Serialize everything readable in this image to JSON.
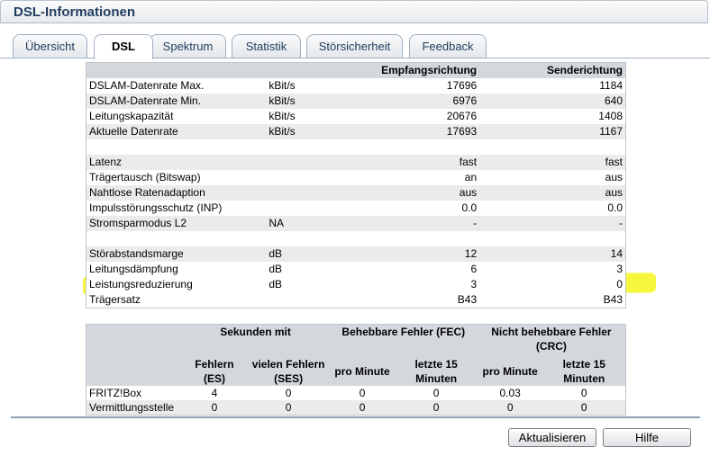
{
  "window": {
    "title": "DSL-Informationen"
  },
  "tabs": [
    {
      "label": "Übersicht"
    },
    {
      "label": "DSL"
    },
    {
      "label": "Spektrum"
    },
    {
      "label": "Statistik"
    },
    {
      "label": "Störsicherheit"
    },
    {
      "label": "Feedback"
    }
  ],
  "active_tab": "DSL",
  "info_table": {
    "headers": [
      "",
      "",
      "Empfangsrichtung",
      "Senderichtung"
    ],
    "rows": [
      [
        "DSLAM-Datenrate Max.",
        "kBit/s",
        "17696",
        "1184"
      ],
      [
        "DSLAM-Datenrate Min.",
        "kBit/s",
        "6976",
        "640"
      ],
      [
        "Leitungskapazität",
        "kBit/s",
        "20676",
        "1408"
      ],
      [
        "Aktuelle Datenrate",
        "kBit/s",
        "17693",
        "1167"
      ],
      [
        "",
        "",
        "",
        ""
      ],
      [
        "Latenz",
        "",
        "fast",
        "fast"
      ],
      [
        "Trägertausch (Bitswap)",
        "",
        "an",
        "aus"
      ],
      [
        "Nahtlose Ratenadaption",
        "",
        "aus",
        "aus"
      ],
      [
        "Impulsstörungsschutz (INP)",
        "",
        "0.0",
        "0.0"
      ],
      [
        "Stromsparmodus L2",
        "NA",
        "-",
        "-"
      ],
      [
        "",
        "",
        "",
        ""
      ],
      [
        "Störabstandsmarge",
        "dB",
        "12",
        "14"
      ],
      [
        "Leitungsdämpfung",
        "dB",
        "6",
        "3"
      ],
      [
        "Leistungsreduzierung",
        "dB",
        "3",
        "0"
      ],
      [
        "Trägersatz",
        "",
        "B43",
        "B43"
      ]
    ]
  },
  "error_table": {
    "group_headers": [
      "Sekunden mit",
      "Behebbare Fehler (FEC)",
      "Nicht behebbare Fehler (CRC)"
    ],
    "sub_headers": [
      "Fehlern (ES)",
      "vielen Fehlern (SES)",
      "pro Minute",
      "letzte 15 Minuten",
      "pro Minute",
      "letzte 15 Minuten"
    ],
    "rows": [
      [
        "FRITZ!Box",
        "4",
        "0",
        "0",
        "0",
        "0.03",
        "0"
      ],
      [
        "Vermittlungsstelle",
        "0",
        "0",
        "0",
        "0",
        "0",
        "0"
      ]
    ]
  },
  "buttons": {
    "refresh": "Aktualisieren",
    "help": "Hilfe"
  },
  "colors": {
    "highlight": "#f4f41b",
    "header_bg": "#d4d8dc",
    "title": "#1f3c5e"
  }
}
